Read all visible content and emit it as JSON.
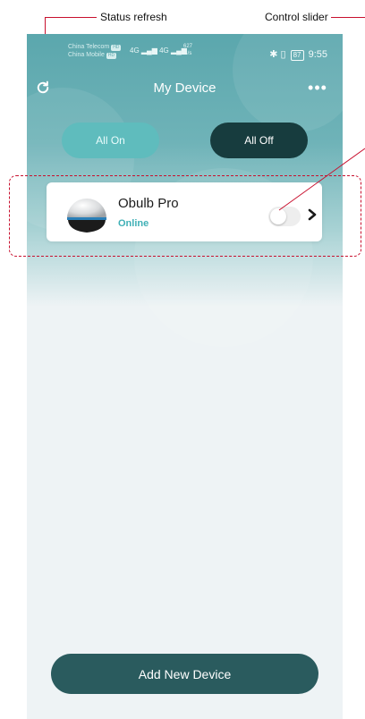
{
  "annotations": {
    "status_refresh": "Status refresh",
    "control_slider": "Control slider"
  },
  "statusbar": {
    "carrier1": "China Telecom",
    "carrier2": "China Mobile",
    "hd_badge": "HD",
    "signal": "4G",
    "speed_value": "627",
    "speed_unit": "B/s",
    "battery": "87",
    "time": "9:55"
  },
  "header": {
    "title": "My Device",
    "more_icon": "more-horizontal-icon",
    "refresh_icon": "refresh-icon"
  },
  "actions": {
    "all_on": "All On",
    "all_off": "All Off"
  },
  "device": {
    "name": "Obulb Pro",
    "status": "Online",
    "toggle_on": false
  },
  "footer": {
    "add_device": "Add New Device"
  },
  "colors": {
    "header_gradient_top": "#5ba7ad",
    "all_on_bg": "#5fbcbd",
    "all_off_bg": "#173c3e",
    "online_text": "#3fb0b6",
    "add_button_bg": "#2a5b5e",
    "annotation_line": "#c8102e"
  }
}
